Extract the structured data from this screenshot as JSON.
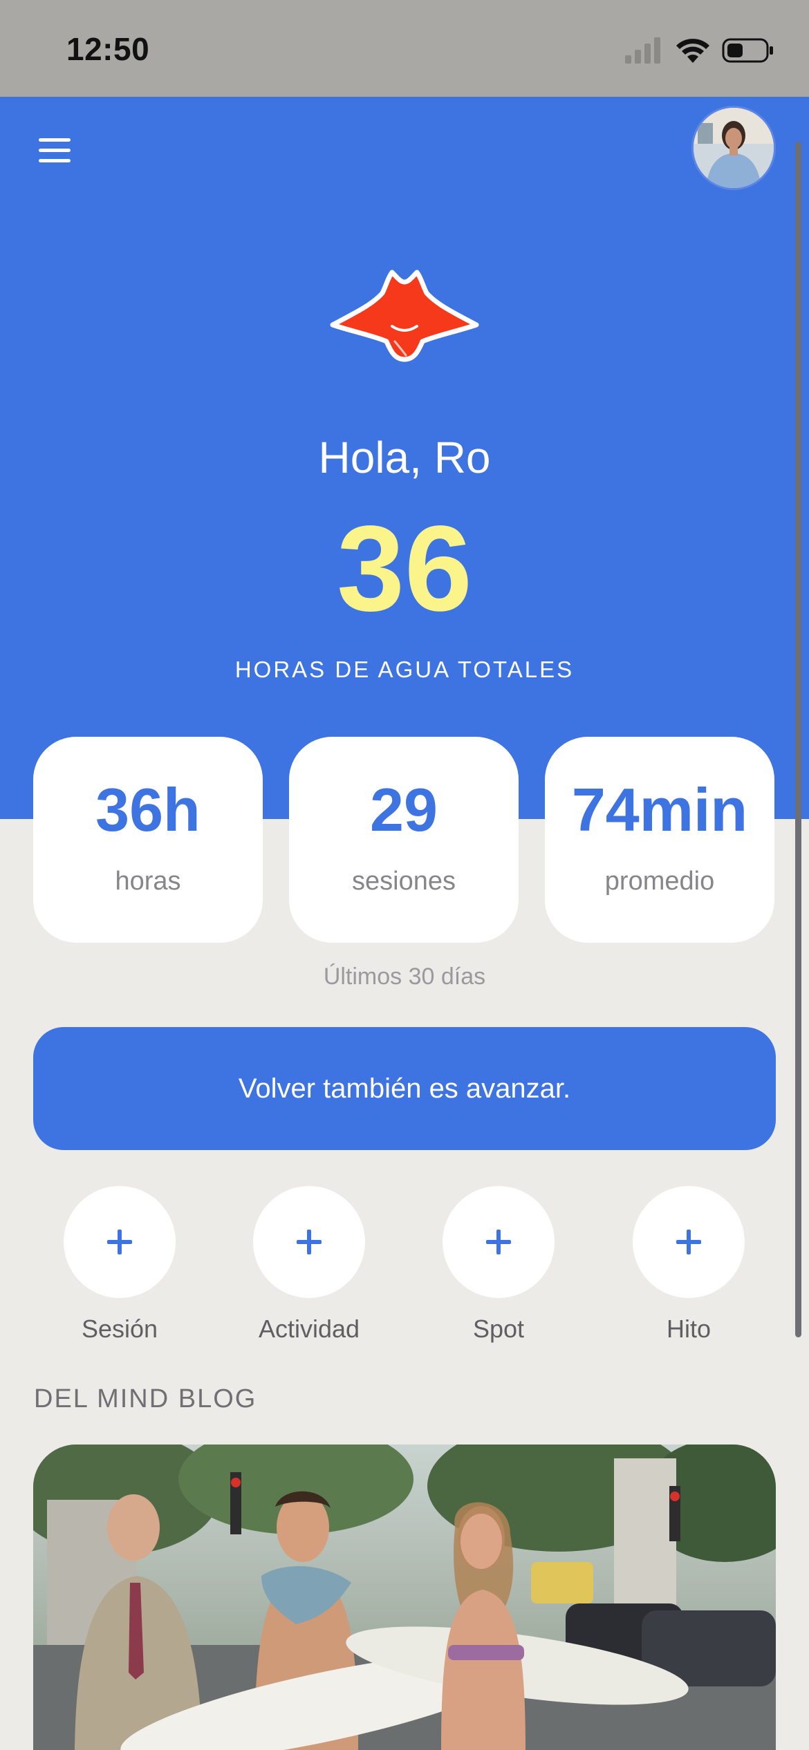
{
  "status_bar": {
    "time": "12:50"
  },
  "header": {
    "menu_icon": "hamburger-menu-icon",
    "avatar_icon": "user-avatar"
  },
  "hero": {
    "logo_icon": "manta-ray-logo",
    "greeting": "Hola, Ro",
    "total_hours": "36",
    "total_caption": "HORAS DE AGUA TOTALES"
  },
  "stats": [
    {
      "value": "36h",
      "label": "horas"
    },
    {
      "value": "29",
      "label": "sesiones"
    },
    {
      "value": "74min",
      "label": "promedio"
    }
  ],
  "stats_period": "Últimos 30 días",
  "quote": "Volver también es avanzar.",
  "actions": [
    {
      "label": "Sesión",
      "icon": "plus-icon"
    },
    {
      "label": "Actividad",
      "icon": "plus-icon"
    },
    {
      "label": "Spot",
      "icon": "plus-icon"
    },
    {
      "label": "Hito",
      "icon": "plus-icon"
    }
  ],
  "blog": {
    "section_title": "DEL MIND BLOG"
  },
  "colors": {
    "primary": "#3e73e2",
    "accent_yellow": "#fbf48a",
    "logo_red": "#f5391a",
    "background": "#ecebe7"
  }
}
